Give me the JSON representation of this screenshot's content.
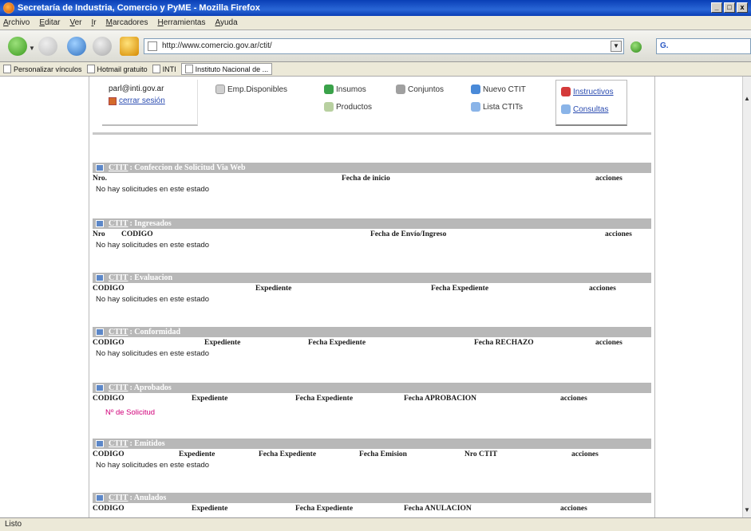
{
  "window": {
    "title": "Secretaría de Industria, Comercio y PyME - Mozilla Firefox",
    "buttons": [
      "_",
      "□",
      "x"
    ]
  },
  "menu": [
    "Archivo",
    "Editar",
    "Ver",
    "Ir",
    "Marcadores",
    "Herramientas",
    "Ayuda"
  ],
  "nav": {
    "url": "http://www.comercio.gov.ar/ctit/",
    "search_placeholder": "G."
  },
  "bookmarks": [
    "Personalizar vínculos",
    "Hotmail gratuito",
    "INTI",
    "Instituto Nacional de ..."
  ],
  "header": {
    "user_email": "parl@inti.gov.ar",
    "logout": "cerrar sesión",
    "links": {
      "emp": "Emp.Disponibles",
      "insumos": "Insumos",
      "conjuntos": "Conjuntos",
      "productos": "Productos",
      "nuevo": "Nuevo CTIT",
      "lista": "Lista CTITs",
      "instructivos": "Instructivos",
      "consultas": "Consultas"
    }
  },
  "sections": [
    {
      "prefix": "CTIT",
      "title": ": Confeccion de Solicitud Via Web",
      "columns": [
        "Nro.",
        "Fecha de inicio",
        "acciones"
      ],
      "message": "No hay solicitudes en este estado"
    },
    {
      "prefix": "CTIT",
      "title": ": Ingresados",
      "columns": [
        "Nro",
        "CODIGO",
        "Fecha de Envío/Ingreso",
        "acciones"
      ],
      "message": "No hay solicitudes en este estado"
    },
    {
      "prefix": "CTIT",
      "title": ": Evaluacion",
      "columns": [
        "CODIGO",
        "Expediente",
        "Fecha Expediente",
        "acciones"
      ],
      "message": "No hay solicitudes en este estado"
    },
    {
      "prefix": "CTIT",
      "title": ": Conformidad",
      "columns": [
        "CODIGO",
        "Expediente",
        "Fecha Expediente",
        "Fecha RECHAZO",
        "acciones"
      ],
      "message": "No hay solicitudes en este estado"
    },
    {
      "prefix": "CTIT",
      "title": ": Aprobados",
      "columns": [
        "CODIGO",
        "Expediente",
        "Fecha Expediente",
        "Fecha APROBACION",
        "acciones"
      ],
      "message": "Nº de Solicitud"
    },
    {
      "prefix": "CTIT",
      "title": ": Emitidos",
      "columns": [
        "CODIGO",
        "Expediente",
        "Fecha Expediente",
        "Fecha Emision",
        "Nro CTIT",
        "acciones"
      ],
      "message": "No hay solicitudes en este estado"
    },
    {
      "prefix": "CTIT",
      "title": ": Anulados",
      "columns": [
        "CODIGO",
        "Expediente",
        "Fecha Expediente",
        "Fecha ANULACION",
        "acciones"
      ],
      "message": ""
    }
  ],
  "status": "Listo"
}
